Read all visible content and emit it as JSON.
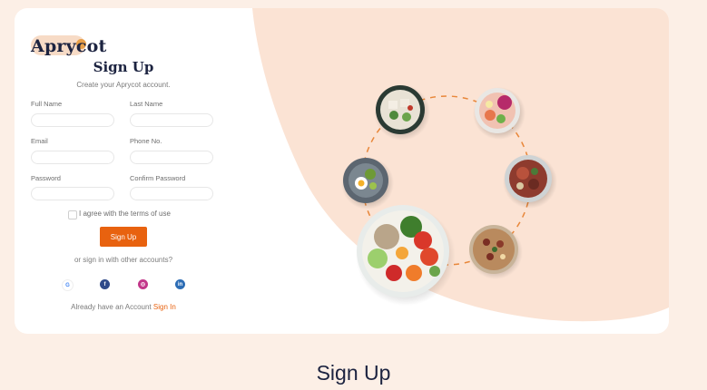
{
  "brand": {
    "logo_text": "Aprycot"
  },
  "form": {
    "title": "Sign Up",
    "subtitle": "Create your Aprycot account.",
    "fields": {
      "full_name": {
        "label": "Full Name",
        "value": ""
      },
      "last_name": {
        "label": "Last Name",
        "value": ""
      },
      "email": {
        "label": "Email",
        "value": ""
      },
      "phone": {
        "label": "Phone No.",
        "value": ""
      },
      "password": {
        "label": "Password",
        "value": ""
      },
      "confirm_password": {
        "label": "Confirm Password",
        "value": ""
      }
    },
    "terms_label": "I agree with the terms of use",
    "terms_checked": false,
    "submit_label": "Sign Up",
    "alt_text": "or sign in with other accounts?",
    "social": [
      {
        "name": "google-icon",
        "glyph": "G",
        "color": "#ffffff"
      },
      {
        "name": "facebook-icon",
        "glyph": "f",
        "color": "#2f4a8a"
      },
      {
        "name": "instagram-icon",
        "glyph": "◎",
        "color": "#c2378a"
      },
      {
        "name": "linkedin-icon",
        "glyph": "in",
        "color": "#2d6db5"
      }
    ],
    "already_text": "Already have an Account",
    "signin_link": "Sign In"
  },
  "colors": {
    "accent": "#e8620f",
    "peach": "#fbe3d4",
    "page_bg": "#fcefe6",
    "navy": "#1c2340"
  },
  "caption": "Sign Up"
}
